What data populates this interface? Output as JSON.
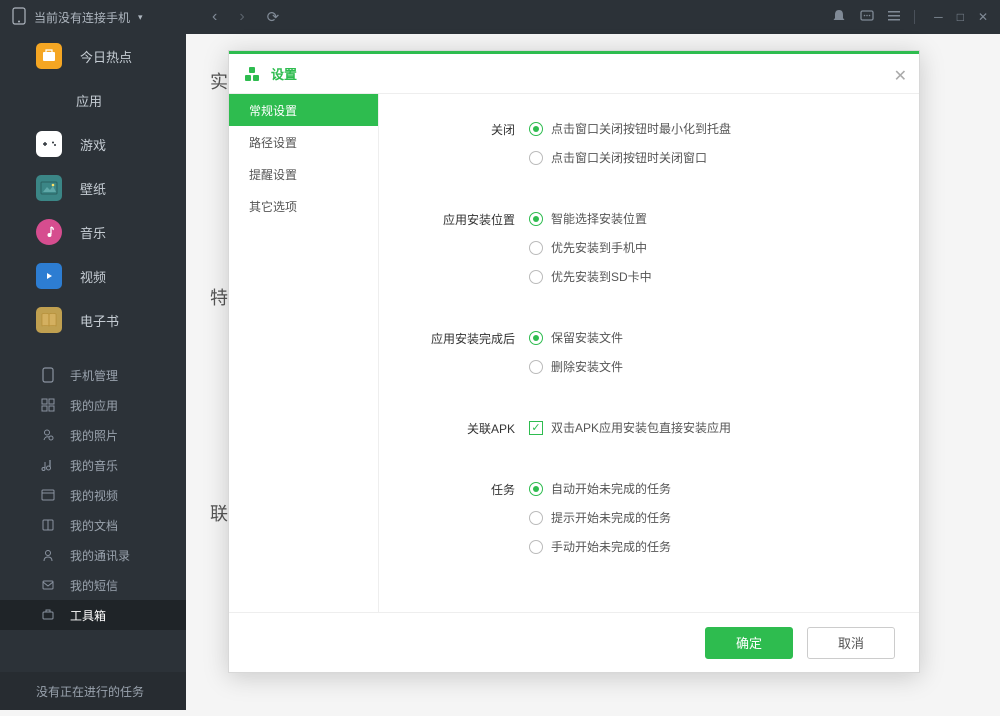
{
  "header": {
    "status": "当前没有连接手机"
  },
  "sidebar": {
    "primary": [
      {
        "label": "今日热点",
        "icon": "hot"
      },
      {
        "label": "应用",
        "icon": "app"
      },
      {
        "label": "游戏",
        "icon": "game"
      },
      {
        "label": "壁纸",
        "icon": "wall"
      },
      {
        "label": "音乐",
        "icon": "music"
      },
      {
        "label": "视频",
        "icon": "video"
      },
      {
        "label": "电子书",
        "icon": "book"
      }
    ],
    "secondary": [
      {
        "label": "手机管理"
      },
      {
        "label": "我的应用"
      },
      {
        "label": "我的照片"
      },
      {
        "label": "我的音乐"
      },
      {
        "label": "我的视频"
      },
      {
        "label": "我的文档"
      },
      {
        "label": "我的通讯录"
      },
      {
        "label": "我的短信"
      },
      {
        "label": "工具箱",
        "active": true
      }
    ],
    "footer": "没有正在进行的任务"
  },
  "main": {
    "hint1": "实",
    "hint2": "特",
    "hint3": "联"
  },
  "dialog": {
    "title": "设置",
    "tabs": [
      "常规设置",
      "路径设置",
      "提醒设置",
      "其它选项"
    ],
    "active_tab": 0,
    "groups": {
      "close": {
        "label": "关闭",
        "options": [
          "点击窗口关闭按钮时最小化到托盘",
          "点击窗口关闭按钮时关闭窗口"
        ],
        "selected": 0
      },
      "install_loc": {
        "label": "应用安装位置",
        "options": [
          "智能选择安装位置",
          "优先安装到手机中",
          "优先安装到SD卡中"
        ],
        "selected": 0
      },
      "after_install": {
        "label": "应用安装完成后",
        "options": [
          "保留安装文件",
          "删除安装文件"
        ],
        "selected": 0
      },
      "apk": {
        "label": "关联APK",
        "check_label": "双击APK应用安装包直接安装应用",
        "checked": true
      },
      "task": {
        "label": "任务",
        "options": [
          "自动开始未完成的任务",
          "提示开始未完成的任务",
          "手动开始未完成的任务"
        ],
        "selected": 0
      }
    },
    "ok": "确定",
    "cancel": "取消"
  }
}
